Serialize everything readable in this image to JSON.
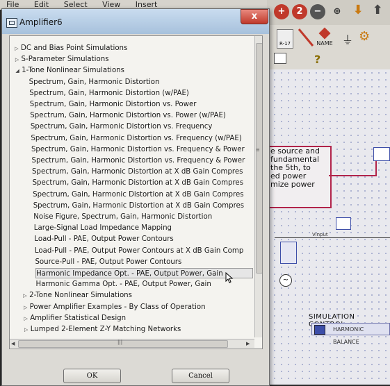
{
  "menubar": [
    "File",
    "Edit",
    "Select",
    "View",
    "Insert"
  ],
  "background": {
    "toolbar_labels": [
      "R-17",
      "NAME"
    ],
    "note_lines": [
      "e source and",
      "fundamental",
      "the 5th, to",
      "ed power",
      "mize power"
    ],
    "labels": {
      "vinput": "Vinput",
      "sim_control": "SIMULATION CONTROL",
      "harmonic_balance": "HARMONIC BALANCE"
    }
  },
  "dialog": {
    "title": "Amplifier6",
    "close_label": "x",
    "ok_label": "OK",
    "cancel_label": "Cancel",
    "tree": [
      {
        "label": "DC and Bias Point Simulations",
        "level": 0,
        "arrow": "▷"
      },
      {
        "label": "S-Parameter Simulations",
        "level": 0,
        "arrow": "▷"
      },
      {
        "label": "1-Tone Nonlinear Simulations",
        "level": 0,
        "arrow": "◢"
      },
      {
        "label": "Spectrum, Gain, Harmonic Distortion",
        "level": 1
      },
      {
        "label": "Spectrum, Gain, Harmonic Distortion (w/PAE)",
        "level": 1
      },
      {
        "label": "Spectrum, Gain, Harmonic Distortion vs. Power",
        "level": 1
      },
      {
        "label": "Spectrum, Gain, Harmonic Distortion vs. Power (w/PAE)",
        "level": 1
      },
      {
        "label": "Spectrum, Gain, Harmonic Distortion vs. Frequency",
        "level": 1
      },
      {
        "label": "Spectrum, Gain, Harmonic Distortion vs. Frequency (w/PAE)",
        "level": 1
      },
      {
        "label": "Spectrum, Gain, Harmonic Distortion vs. Frequency & Power",
        "level": 1
      },
      {
        "label": "Spectrum, Gain, Harmonic Distortion vs. Frequency & Power",
        "level": 1
      },
      {
        "label": "Spectrum, Gain, Harmonic Distortion at X dB Gain Compres",
        "level": 1
      },
      {
        "label": "Spectrum, Gain, Harmonic Distortion at X dB Gain Compres",
        "level": 1
      },
      {
        "label": "Spectrum, Gain, Harmonic Distortion at X dB Gain Compres",
        "level": 1
      },
      {
        "label": "Spectrum, Gain, Harmonic Distortion at X dB Gain Compres",
        "level": 1
      },
      {
        "label": "Noise Figure, Spectrum, Gain, Harmonic Distortion",
        "level": 1
      },
      {
        "label": "Large-Signal Load Impedance Mapping",
        "level": 1
      },
      {
        "label": "Load-Pull - PAE, Output Power Contours",
        "level": 1
      },
      {
        "label": "Load-Pull - PAE, Output Power Contours at X dB Gain Comp",
        "level": 1
      },
      {
        "label": "Source-Pull - PAE, Output Power Contours",
        "level": 1
      },
      {
        "label": "Harmonic Impedance Opt. - PAE, Output Power, Gain",
        "level": 1,
        "selected": true
      },
      {
        "label": "Harmonic Gamma Opt. - PAE, Output Power, Gain",
        "level": 1
      },
      {
        "label": "2-Tone Nonlinear Simulations",
        "level": 0,
        "arrow": "▷"
      },
      {
        "label": "Power Amplifier Examples - By Class of Operation",
        "level": 0,
        "arrow": "▷"
      },
      {
        "label": "Amplifier Statistical Design",
        "level": 0,
        "arrow": "▷"
      },
      {
        "label": "Lumped 2-Element Z-Y Matching Networks",
        "level": 0,
        "arrow": "▷"
      }
    ]
  }
}
